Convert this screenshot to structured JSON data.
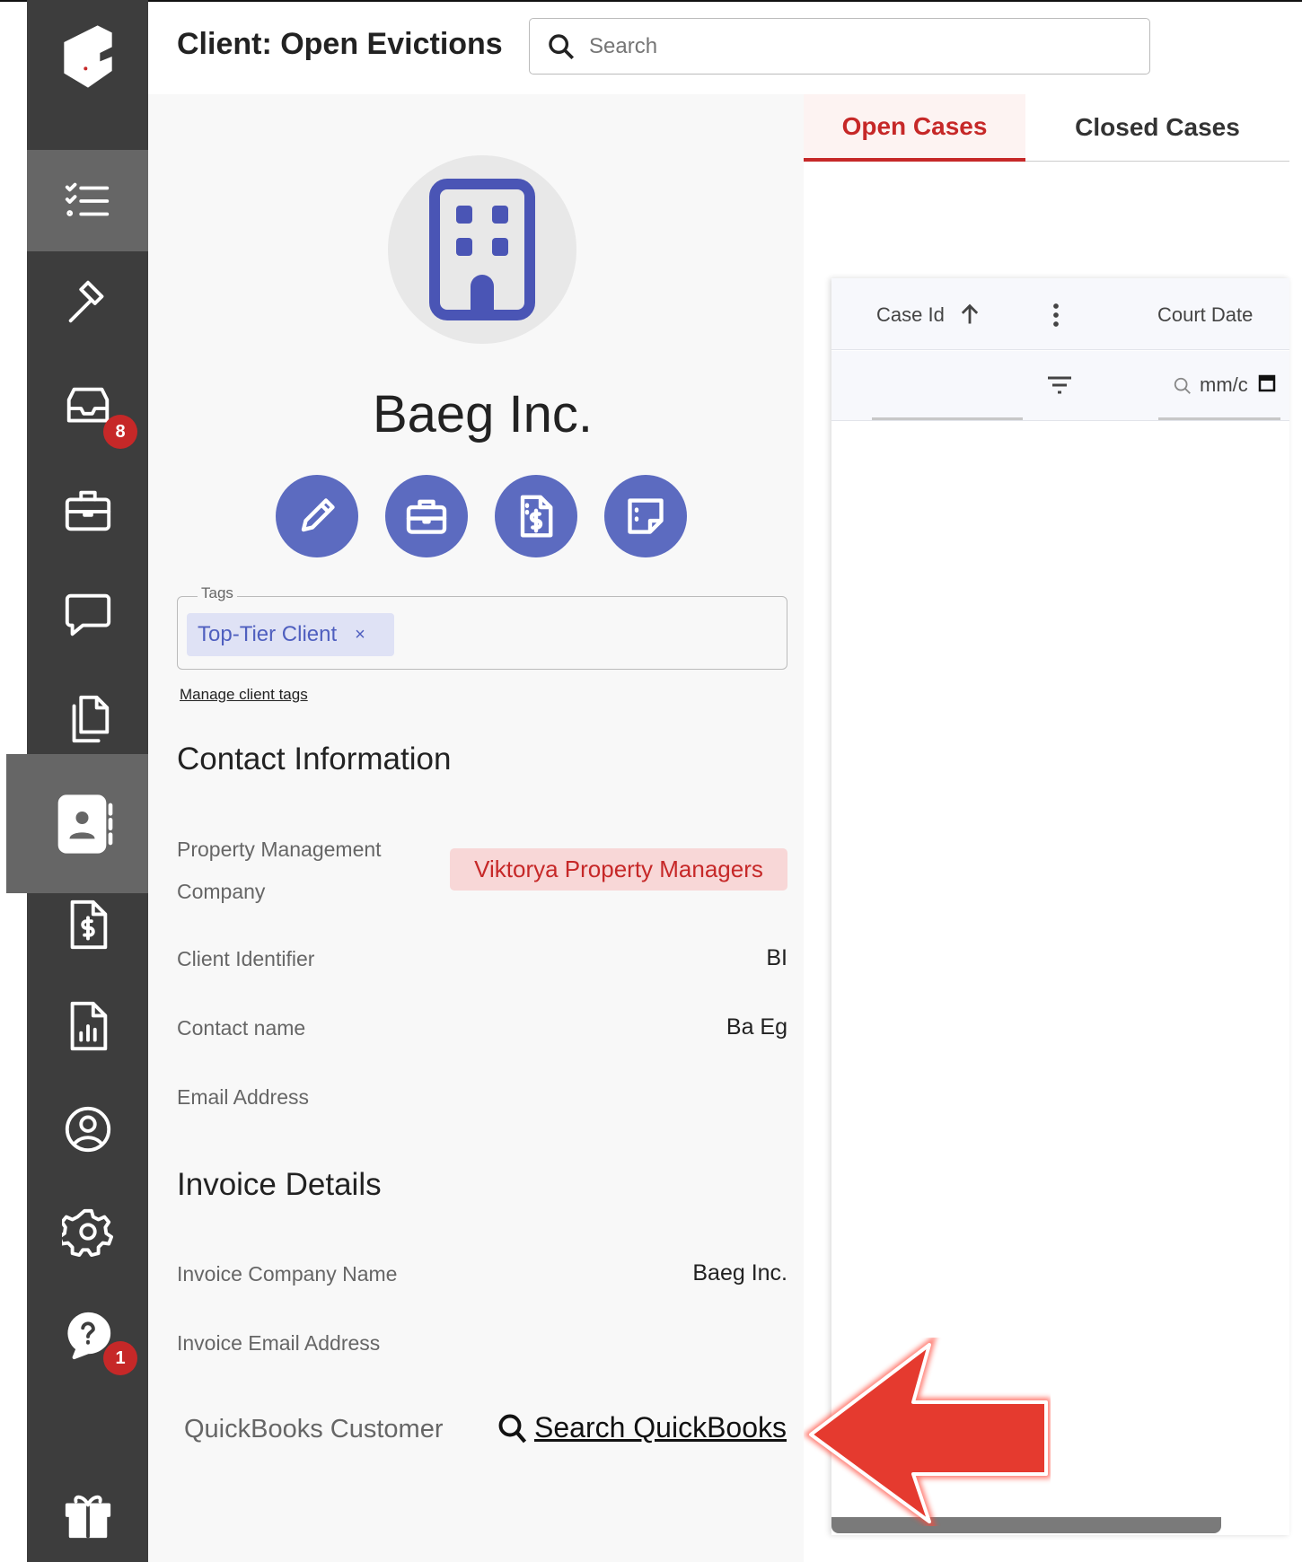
{
  "header": {
    "title": "Client: Open Evictions",
    "search_placeholder": "Search"
  },
  "sidebar": {
    "items": [
      {
        "name": "tasks",
        "icon": "checklist-icon"
      },
      {
        "name": "cases",
        "icon": "gavel-icon"
      },
      {
        "name": "inbox",
        "icon": "inbox-icon",
        "badge": "8"
      },
      {
        "name": "jobs",
        "icon": "briefcase-icon"
      },
      {
        "name": "messages",
        "icon": "chat-icon"
      },
      {
        "name": "documents",
        "icon": "copy-icon"
      },
      {
        "name": "clients",
        "icon": "contact-book-icon",
        "active": true
      },
      {
        "name": "invoices",
        "icon": "invoice-icon"
      },
      {
        "name": "reports",
        "icon": "report-icon"
      },
      {
        "name": "account",
        "icon": "user-circle-icon"
      },
      {
        "name": "settings",
        "icon": "gear-icon"
      },
      {
        "name": "help",
        "icon": "help-chat-icon",
        "badge": "1"
      },
      {
        "name": "gifts",
        "icon": "gift-icon"
      }
    ]
  },
  "client": {
    "name": "Baeg Inc.",
    "tags_label": "Tags",
    "tags": [
      "Top-Tier Client"
    ],
    "tag_remove": "×",
    "manage_tags": "Manage client tags"
  },
  "contact": {
    "heading": "Contact Information",
    "pmc_label_1": "Property Management",
    "pmc_label_2": "Company",
    "pmc_value": "Viktorya Property Managers",
    "client_identifier_label": "Client Identifier",
    "client_identifier": "BI",
    "contact_name_label": "Contact name",
    "contact_name": "Ba Eg",
    "email_label": "Email Address"
  },
  "invoice": {
    "heading": "Invoice Details",
    "company_label": "Invoice Company Name",
    "company": "Baeg Inc.",
    "email_label": "Invoice Email Address",
    "qb_label": "QuickBooks Customer",
    "qb_link": "Search QuickBooks"
  },
  "tabs": {
    "open": "Open Cases",
    "closed": "Closed Cases"
  },
  "table": {
    "col_case_id": "Case Id",
    "col_court_date": "Court Date",
    "date_placeholder": "mm/c"
  },
  "colors": {
    "accent": "#5c6bc0",
    "danger": "#c62828",
    "sidebar": "#3d3d3d"
  }
}
